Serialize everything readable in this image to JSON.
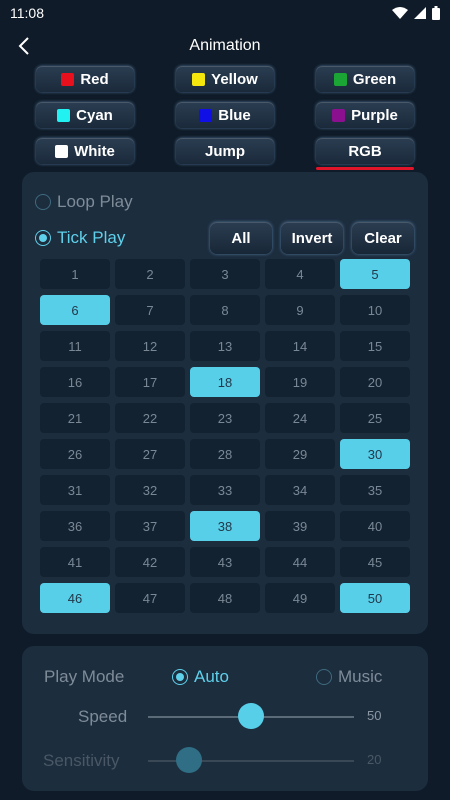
{
  "status": {
    "time": "11:08"
  },
  "header": {
    "title": "Animation"
  },
  "colors": [
    {
      "label": "Red",
      "swatch": "#e8101c"
    },
    {
      "label": "Yellow",
      "swatch": "#f5e70d"
    },
    {
      "label": "Green",
      "swatch": "#1aa534"
    },
    {
      "label": "Cyan",
      "swatch": "#22f1f1"
    },
    {
      "label": "Blue",
      "swatch": "#1010e6"
    },
    {
      "label": "Purple",
      "swatch": "#8a1090"
    },
    {
      "label": "White",
      "swatch": "#ffffff"
    },
    {
      "label": "Jump",
      "swatch": ""
    },
    {
      "label": "RGB",
      "swatch": ""
    }
  ],
  "mode": {
    "loop_label": "Loop Play",
    "tick_label": "Tick Play",
    "selected": "Tick Play"
  },
  "actions": {
    "all": "All",
    "invert": "Invert",
    "clear": "Clear"
  },
  "grid": {
    "numbers": [
      1,
      2,
      3,
      4,
      5,
      6,
      7,
      8,
      9,
      10,
      11,
      12,
      13,
      14,
      15,
      16,
      17,
      18,
      19,
      20,
      21,
      22,
      23,
      24,
      25,
      26,
      27,
      28,
      29,
      30,
      31,
      32,
      33,
      34,
      35,
      36,
      37,
      38,
      39,
      40,
      41,
      42,
      43,
      44,
      45,
      46,
      47,
      48,
      49,
      50
    ],
    "selected": [
      5,
      6,
      18,
      30,
      38,
      46,
      50
    ]
  },
  "play": {
    "play_mode_label": "Play Mode",
    "auto_label": "Auto",
    "music_label": "Music",
    "selected": "Auto",
    "speed_label": "Speed",
    "speed_value": "50",
    "speed_fraction": 0.5,
    "sensitivity_label": "Sensitivity",
    "sensitivity_value": "20",
    "sensitivity_fraction": 0.2
  },
  "theme": {
    "accent": "#58cfe9",
    "highlight": "#e0152a"
  }
}
